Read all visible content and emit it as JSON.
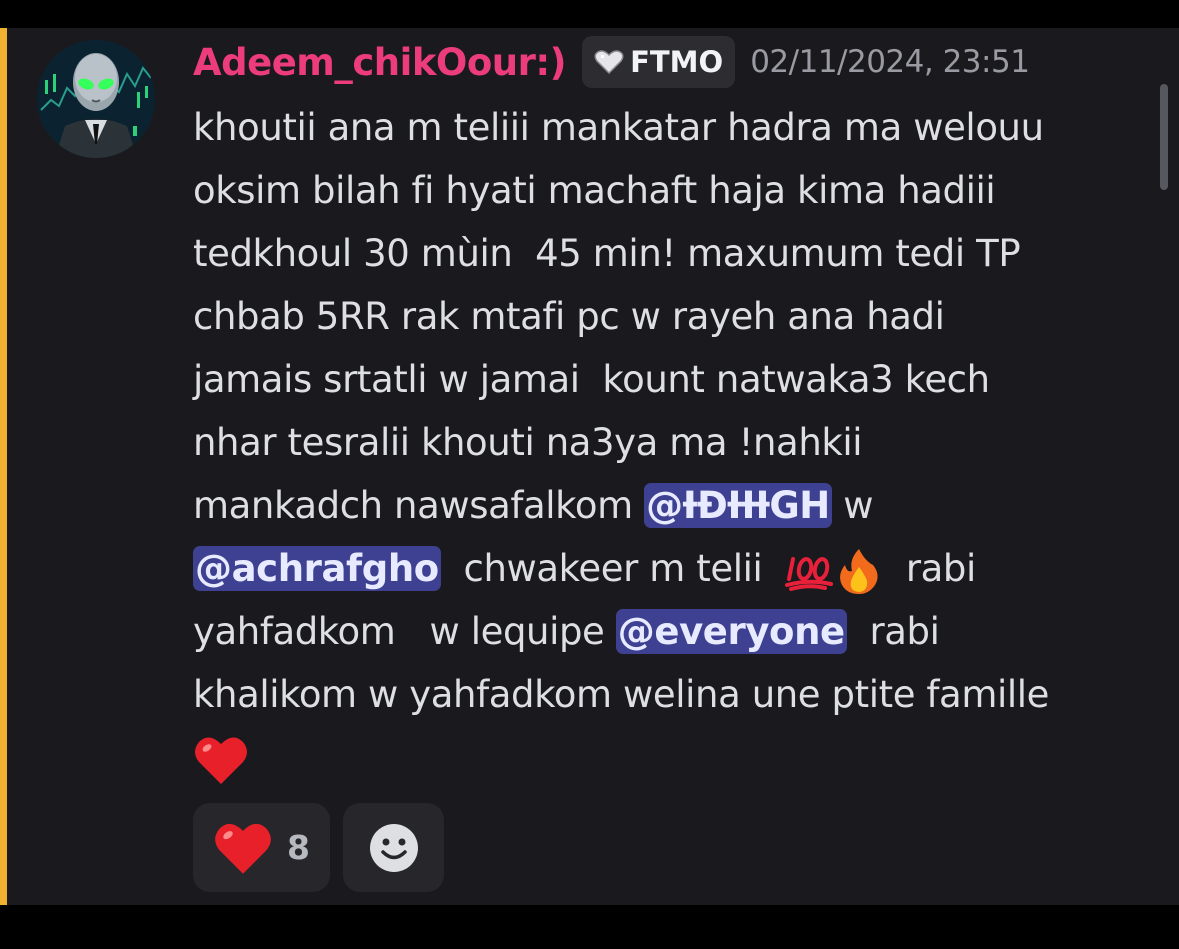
{
  "colors": {
    "background": "#1a1a1e",
    "mention_highlight_bar": "#f0b132",
    "username": "#ec3c7c",
    "mention_bg": "#3e4192",
    "text": "#dedfe3",
    "timestamp": "#9a9ba2"
  },
  "message": {
    "avatar_icon": "alien-trader-avatar",
    "username": "Adeem_chikOour:)",
    "server_tag": {
      "icon": "heart-icon",
      "label": "FTMO"
    },
    "timestamp": "02/11/2024, 23:51",
    "lines": [
      "khoutii ana m teliii mankatar hadra ma welouu",
      "oksim bilah fi hyati machaft haja kima hadiii",
      "tedkhoul 30 mùin  45 min! maxumum tedi TP",
      "chbab 5RR rak mtafi pc w rayeh ana hadi",
      "jamais srtatli w jamai  kount natwaka3 kech",
      "nhar tesralii khouti na3ya ma !nahkii"
    ],
    "line7": {
      "before": "mankadch nawsafalkom ",
      "mention": "@ƗĐƗƗƗGH",
      "after": " w"
    },
    "line8": {
      "mention": "@achrafgho",
      "after": "  chwakeer m telii  ",
      "emoji1": "hundred-points-emoji",
      "emoji2": "fire-emoji",
      "tail": "  rabi"
    },
    "line9": {
      "before": "yahfadkom   w lequipe ",
      "mention": "@everyone",
      "after": "  rabi"
    },
    "line10": "khalikom w yahfadkom welina une ptite famille",
    "end_emoji": "red-heart-emoji"
  },
  "reactions": [
    {
      "emoji": "red-heart-emoji",
      "count": "8"
    },
    {
      "emoji": "add-reaction-smiley-icon"
    }
  ]
}
